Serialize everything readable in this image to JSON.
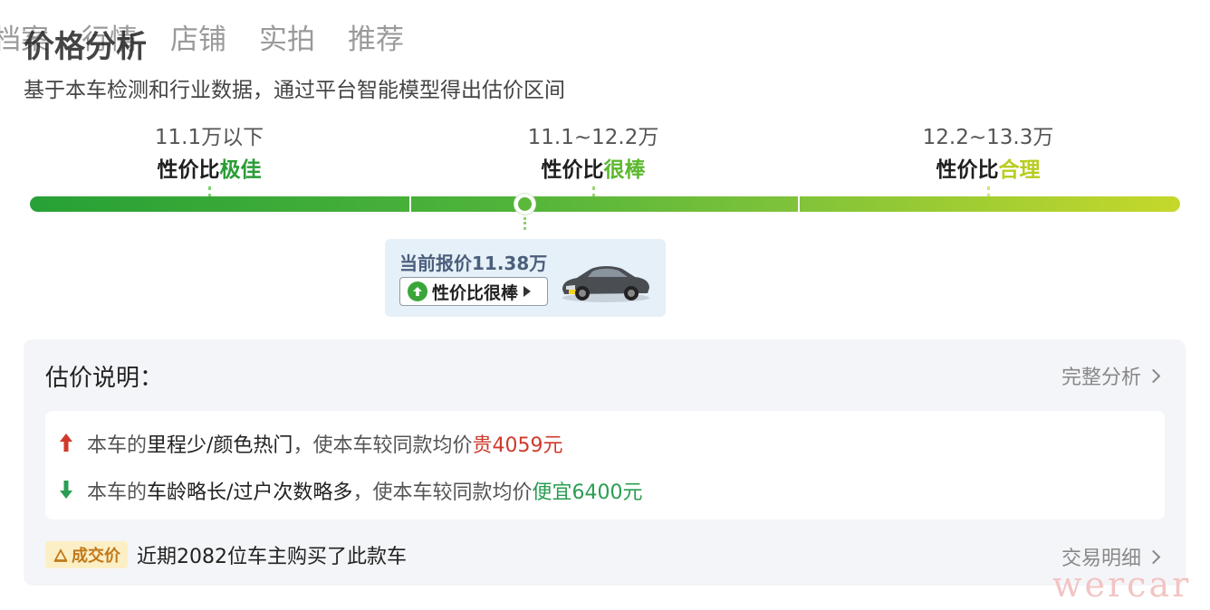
{
  "tabs": [
    "档案",
    "行情",
    "店铺",
    "实拍",
    "推荐"
  ],
  "section": {
    "title": "价格分析",
    "subtitle": "基于本车检测和行业数据，通过平台智能模型得出估价区间"
  },
  "ranges": [
    {
      "price": "11.1万以下",
      "rating_prefix": "性价比",
      "rating": "极佳",
      "color": "#2a9d36"
    },
    {
      "price": "11.1~12.2万",
      "rating_prefix": "性价比",
      "rating": "很棒",
      "color": "#5cb82f"
    },
    {
      "price": "12.2~13.3万",
      "rating_prefix": "性价比",
      "rating": "合理",
      "color": "#b8cc20"
    }
  ],
  "current": {
    "label": "当前报价11.38万",
    "badge": "性价比很棒",
    "badge_icon": "arrow-up-circle-icon",
    "image": "car-thumbnail"
  },
  "explanation": {
    "title": "估价说明：",
    "link": "完整分析",
    "reasons": [
      {
        "direction": "up",
        "icon": "arrow-up-icon",
        "prefix": "本车的",
        "factor": "里程少/颜色热门",
        "middle": "，使本车较同款均价",
        "effect": "贵4059元"
      },
      {
        "direction": "down",
        "icon": "arrow-down-icon",
        "prefix": "本车的",
        "factor": "车龄略长/过户次数略多",
        "middle": "，使本车较同款均价",
        "effect": "便宜6400元"
      }
    ]
  },
  "deal": {
    "tag": "成交价",
    "text": "近期2082位车主购买了此款车",
    "link": "交易明细"
  },
  "watermark": "wercar",
  "colors": {
    "bar_start": "#27a136",
    "bar_end": "#c6d82b",
    "price_up": "#d0392b",
    "price_down": "#2a9d52"
  }
}
